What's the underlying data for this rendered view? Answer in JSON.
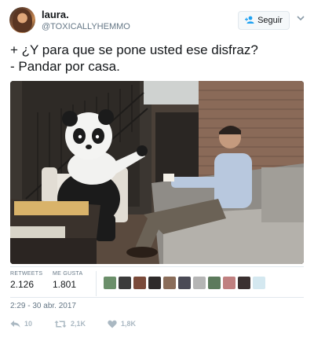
{
  "user": {
    "name": "laura.",
    "handle": "@TOXICALLYHEMMO"
  },
  "follow_button": {
    "label": "Seguir",
    "icon": "add-user-icon"
  },
  "tweet": {
    "lines": [
      "+ ¿Y para que se pone usted ese disfraz?",
      "- Pandar por casa."
    ]
  },
  "stats": {
    "retweets_label": "RETWEETS",
    "retweets_value": "2.126",
    "likes_label": "ME GUSTA",
    "likes_value": "1.801",
    "liker_colors": [
      "#6b8f6a",
      "#3b3b3b",
      "#7a4a3a",
      "#2e2a2a",
      "#8a6d5a",
      "#4a4a55",
      "#b5b5b5",
      "#5c7a5c",
      "#c08080",
      "#3a3030",
      "#d4e8f0"
    ]
  },
  "timestamp": "2:29 - 30 abr. 2017",
  "actions": {
    "reply": "10",
    "retweet": "2,1K",
    "like": "1,8K"
  },
  "colors": {
    "accent": "#1da1f2",
    "muted": "#657786",
    "icon": "#aab8c2"
  }
}
